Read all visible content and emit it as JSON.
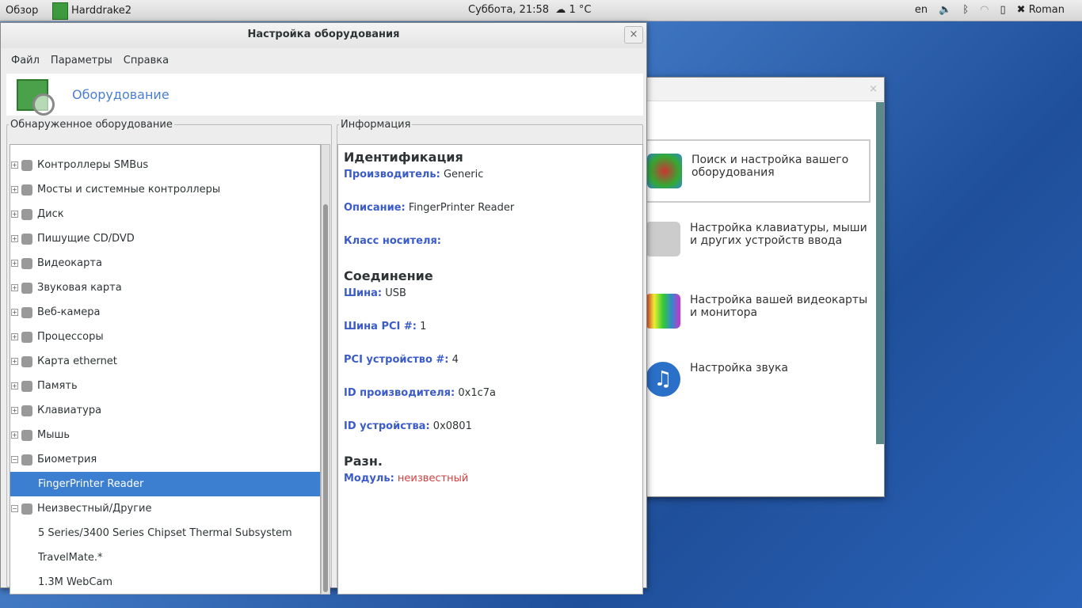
{
  "topbar": {
    "activities": "Обзор",
    "app": "Harddrake2",
    "clock": "Суббота, 21:58",
    "weather": "1 °C",
    "lang": "en",
    "user": "Roman"
  },
  "window": {
    "title": "Настройка оборудования",
    "close": "×",
    "menu": [
      "Файл",
      "Параметры",
      "Справка"
    ],
    "header": "Оборудование",
    "left_legend": "Обнаруженное оборудование",
    "right_legend": "Информация",
    "tree": [
      {
        "label": "Контроллеры SMBus",
        "type": "cat",
        "exp": "+"
      },
      {
        "label": "Мосты и системные контроллеры",
        "type": "cat",
        "exp": "+"
      },
      {
        "label": "Диск",
        "type": "cat",
        "exp": "+"
      },
      {
        "label": "Пишущие CD/DVD",
        "type": "cat",
        "exp": "+"
      },
      {
        "label": "Видеокарта",
        "type": "cat",
        "exp": "+"
      },
      {
        "label": "Звуковая карта",
        "type": "cat",
        "exp": "+"
      },
      {
        "label": "Веб-камера",
        "type": "cat",
        "exp": "+"
      },
      {
        "label": "Процессоры",
        "type": "cat",
        "exp": "+"
      },
      {
        "label": "Карта ethernet",
        "type": "cat",
        "exp": "+"
      },
      {
        "label": "Память",
        "type": "cat",
        "exp": "+"
      },
      {
        "label": "Клавиатура",
        "type": "cat",
        "exp": "+"
      },
      {
        "label": "Мышь",
        "type": "cat",
        "exp": "+"
      },
      {
        "label": "Биометрия",
        "type": "cat",
        "exp": "−"
      },
      {
        "label": "FingerPrinter Reader",
        "type": "child",
        "selected": true
      },
      {
        "label": "Неизвестный/Другие",
        "type": "cat",
        "exp": "−"
      },
      {
        "label": "5 Series/3400 Series Chipset Thermal Subsystem",
        "type": "child"
      },
      {
        "label": "TravelMate.*",
        "type": "child"
      },
      {
        "label": "1.3M WebCam",
        "type": "child"
      }
    ],
    "info": {
      "ident_h": "Идентификация",
      "vendor_k": "Производитель:",
      "vendor_v": "Generic",
      "desc_k": "Описание:",
      "desc_v": "FingerPrinter Reader",
      "class_k": "Класс носителя:",
      "conn_h": "Соединение",
      "bus_k": "Шина:",
      "bus_v": "USB",
      "pcibus_k": "Шина PCI #:",
      "pcibus_v": "1",
      "pcidev_k": "PCI устройство #:",
      "pcidev_v": "4",
      "vid_k": "ID производителя:",
      "vid_v": "0x1c7a",
      "did_k": "ID устройства:",
      "did_v": "0x0801",
      "misc_h": "Разн.",
      "mod_k": "Модуль:",
      "mod_v": "неизвестный"
    }
  },
  "bgwindow": {
    "close": "×",
    "items": [
      "Поиск и настройка вашего оборудования",
      "Настройка клавиатуры, мыши и других устройств ввода",
      "Настройка вашей видеокарты и монитора",
      "Настройка звука"
    ]
  }
}
